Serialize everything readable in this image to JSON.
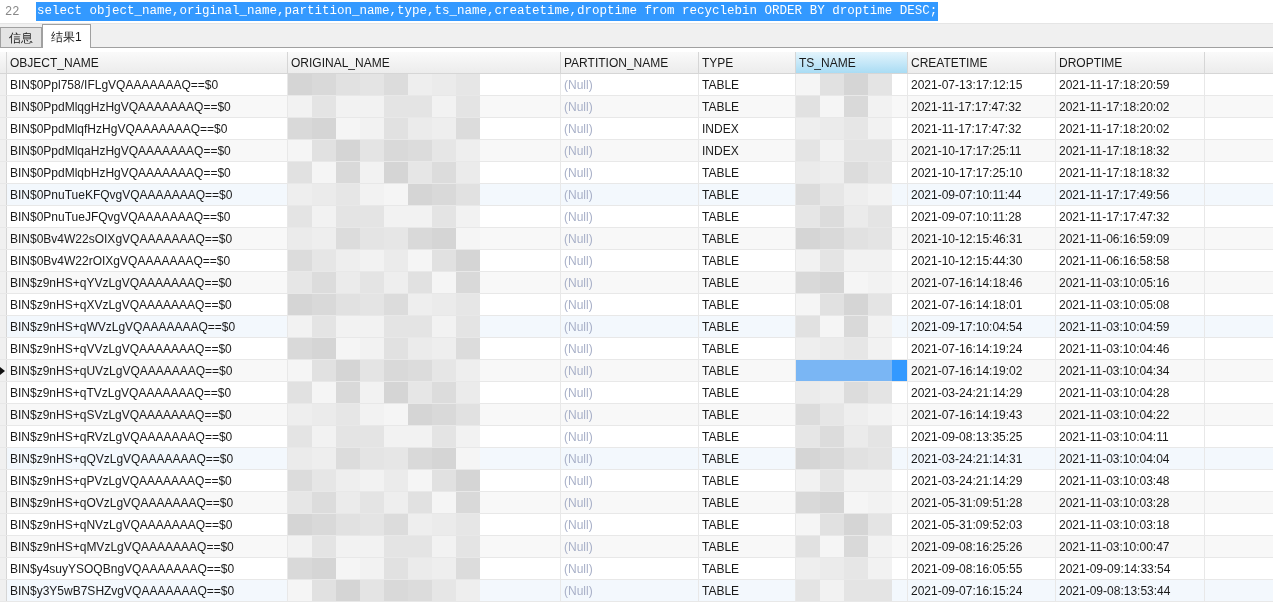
{
  "editor": {
    "line_number": "22",
    "sql": "select object_name,original_name,partition_name,type,ts_name,createtime,droptime from recyclebin ORDER BY droptime DESC;",
    "selected": true
  },
  "tabs": [
    {
      "label": "信息",
      "selected": false
    },
    {
      "label": "结果1",
      "selected": true
    }
  ],
  "table": {
    "columns": [
      {
        "label": "OBJECT_NAME",
        "kind": "text",
        "selected": false
      },
      {
        "label": "ORIGINAL_NAME",
        "kind": "redacted",
        "selected": false
      },
      {
        "label": "PARTITION_NAME",
        "kind": "null",
        "selected": false
      },
      {
        "label": "TYPE",
        "kind": "text",
        "selected": false
      },
      {
        "label": "TS_NAME",
        "kind": "redacted",
        "selected": true
      },
      {
        "label": "CREATETIME",
        "kind": "text",
        "selected": false
      },
      {
        "label": "DROPTIME",
        "kind": "text",
        "selected": false
      }
    ],
    "rows": [
      {
        "selected": false,
        "cells": [
          "BIN$0Ppl758/IFLgVQAAAAAAAQ==$0",
          "",
          "(Null)",
          "TABLE",
          "",
          "2021-07-13:17:12:15",
          "2021-11-17:18:20:59"
        ]
      },
      {
        "selected": false,
        "cells": [
          "BIN$0PpdMlqgHzHgVQAAAAAAAQ==$0",
          "",
          "(Null)",
          "TABLE",
          "",
          "2021-11-17:17:47:32",
          "2021-11-17:18:20:02"
        ]
      },
      {
        "selected": false,
        "cells": [
          "BIN$0PpdMlqfHzHgVQAAAAAAAQ==$0",
          "",
          "(Null)",
          "INDEX",
          "",
          "2021-11-17:17:47:32",
          "2021-11-17:18:20:02"
        ]
      },
      {
        "selected": false,
        "cells": [
          "BIN$0PpdMlqaHzHgVQAAAAAAAQ==$0",
          "",
          "(Null)",
          "INDEX",
          "",
          "2021-10-17:17:25:11",
          "2021-11-17:18:18:32"
        ]
      },
      {
        "selected": false,
        "cells": [
          "BIN$0PpdMlqbHzHgVQAAAAAAAQ==$0",
          "",
          "(Null)",
          "TABLE",
          "",
          "2021-10-17:17:25:10",
          "2021-11-17:18:18:32"
        ]
      },
      {
        "selected": false,
        "cells": [
          "BIN$0PnuTueKFQvgVQAAAAAAAQ==$0",
          "",
          "(Null)",
          "TABLE",
          "",
          "2021-09-07:10:11:44",
          "2021-11-17:17:49:56"
        ]
      },
      {
        "selected": false,
        "cells": [
          "BIN$0PnuTueJFQvgVQAAAAAAAQ==$0",
          "",
          "(Null)",
          "TABLE",
          "",
          "2021-09-07:10:11:28",
          "2021-11-17:17:47:32"
        ]
      },
      {
        "selected": false,
        "cells": [
          "BIN$0Bv4W22sOIXgVQAAAAAAAQ==$0",
          "",
          "(Null)",
          "TABLE",
          "",
          "2021-10-12:15:46:31",
          "2021-11-06:16:59:09"
        ]
      },
      {
        "selected": false,
        "cells": [
          "BIN$0Bv4W22rOIXgVQAAAAAAAQ==$0",
          "",
          "(Null)",
          "TABLE",
          "",
          "2021-10-12:15:44:30",
          "2021-11-06:16:58:58"
        ]
      },
      {
        "selected": false,
        "cells": [
          "BIN$z9nHS+qYVzLgVQAAAAAAAQ==$0",
          "",
          "(Null)",
          "TABLE",
          "",
          "2021-07-16:14:18:46",
          "2021-11-03:10:05:16"
        ]
      },
      {
        "selected": false,
        "cells": [
          "BIN$z9nHS+qXVzLgVQAAAAAAAQ==$0",
          "",
          "(Null)",
          "TABLE",
          "",
          "2021-07-16:14:18:01",
          "2021-11-03:10:05:08"
        ]
      },
      {
        "selected": false,
        "cells": [
          "BIN$z9nHS+qWVzLgVQAAAAAAAQ==$0",
          "",
          "(Null)",
          "TABLE",
          "",
          "2021-09-17:10:04:54",
          "2021-11-03:10:04:59"
        ]
      },
      {
        "selected": false,
        "cells": [
          "BIN$z9nHS+qVVzLgVQAAAAAAAQ==$0",
          "",
          "(Null)",
          "TABLE",
          "",
          "2021-07-16:14:19:24",
          "2021-11-03:10:04:46"
        ]
      },
      {
        "selected": true,
        "cells": [
          "BIN$z9nHS+qUVzLgVQAAAAAAAQ==$0",
          "",
          "(Null)",
          "TABLE",
          "",
          "2021-07-16:14:19:02",
          "2021-11-03:10:04:34"
        ]
      },
      {
        "selected": false,
        "cells": [
          "BIN$z9nHS+qTVzLgVQAAAAAAAQ==$0",
          "",
          "(Null)",
          "TABLE",
          "",
          "2021-03-24:21:14:29",
          "2021-11-03:10:04:28"
        ]
      },
      {
        "selected": false,
        "cells": [
          "BIN$z9nHS+qSVzLgVQAAAAAAAQ==$0",
          "",
          "(Null)",
          "TABLE",
          "",
          "2021-07-16:14:19:43",
          "2021-11-03:10:04:22"
        ]
      },
      {
        "selected": false,
        "cells": [
          "BIN$z9nHS+qRVzLgVQAAAAAAAQ==$0",
          "",
          "(Null)",
          "TABLE",
          "",
          "2021-09-08:13:35:25",
          "2021-11-03:10:04:11"
        ]
      },
      {
        "selected": false,
        "cells": [
          "BIN$z9nHS+qQVzLgVQAAAAAAAQ==$0",
          "",
          "(Null)",
          "TABLE",
          "",
          "2021-03-24:21:14:31",
          "2021-11-03:10:04:04"
        ]
      },
      {
        "selected": false,
        "cells": [
          "BIN$z9nHS+qPVzLgVQAAAAAAAQ==$0",
          "",
          "(Null)",
          "TABLE",
          "",
          "2021-03-24:21:14:29",
          "2021-11-03:10:03:48"
        ]
      },
      {
        "selected": false,
        "cells": [
          "BIN$z9nHS+qOVzLgVQAAAAAAAQ==$0",
          "",
          "(Null)",
          "TABLE",
          "",
          "2021-05-31:09:51:28",
          "2021-11-03:10:03:28"
        ]
      },
      {
        "selected": false,
        "cells": [
          "BIN$z9nHS+qNVzLgVQAAAAAAAQ==$0",
          "",
          "(Null)",
          "TABLE",
          "",
          "2021-05-31:09:52:03",
          "2021-11-03:10:03:18"
        ]
      },
      {
        "selected": false,
        "cells": [
          "BIN$z9nHS+qMVzLgVQAAAAAAAQ==$0",
          "",
          "(Null)",
          "TABLE",
          "",
          "2021-09-08:16:25:26",
          "2021-11-03:10:00:47"
        ]
      },
      {
        "selected": false,
        "cells": [
          "BIN$y4suyYSOQBngVQAAAAAAAQ==$0",
          "",
          "(Null)",
          "TABLE",
          "",
          "2021-09-08:16:05:55",
          "2021-09-09:14:33:54"
        ]
      },
      {
        "selected": false,
        "cells": [
          "BIN$y3Y5wB7SHZvgVQAAAAAAAQ==$0",
          "",
          "(Null)",
          "TABLE",
          "",
          "2021-09-07:16:15:24",
          "2021-09-08:13:53:44"
        ]
      }
    ]
  }
}
